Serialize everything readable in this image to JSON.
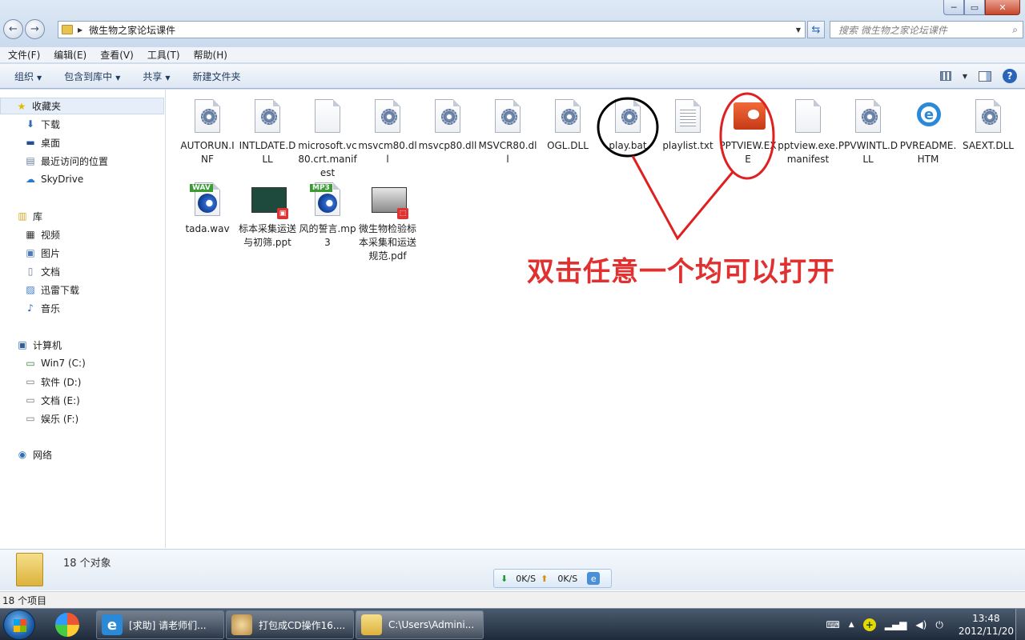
{
  "window": {
    "min_glyph": "─",
    "max_glyph": "▭",
    "close_glyph": "✕"
  },
  "address": {
    "path": "微生物之家论坛课件",
    "search_placeholder": "搜索 微生物之家论坛课件"
  },
  "menu": [
    "文件(F)",
    "编辑(E)",
    "查看(V)",
    "工具(T)",
    "帮助(H)"
  ],
  "commands": {
    "organize": "组织",
    "include_in_library": "包含到库中",
    "share": "共享",
    "new_folder": "新建文件夹"
  },
  "sidebar": {
    "favorites": {
      "label": "收藏夹",
      "items": [
        "下载",
        "桌面",
        "最近访问的位置",
        "SkyDrive"
      ]
    },
    "libraries": {
      "label": "库",
      "items": [
        "视频",
        "图片",
        "文档",
        "迅雷下载",
        "音乐"
      ]
    },
    "computer": {
      "label": "计算机",
      "items": [
        "Win7 (C:)",
        "软件 (D:)",
        "文档 (E:)",
        "娱乐 (F:)"
      ]
    },
    "network": {
      "label": "网络"
    }
  },
  "files": [
    {
      "name": "AUTORUN.INF",
      "icon": "config-gear-icon"
    },
    {
      "name": "INTLDATE.DLL",
      "icon": "config-gear-icon"
    },
    {
      "name": "microsoft.vc80.crt.manifest",
      "icon": "blank-file-icon"
    },
    {
      "name": "msvcm80.dll",
      "icon": "config-gear-icon"
    },
    {
      "name": "msvcp80.dll",
      "icon": "config-gear-icon"
    },
    {
      "name": "MSVCR80.dll",
      "icon": "config-gear-icon"
    },
    {
      "name": "OGL.DLL",
      "icon": "config-gear-icon"
    },
    {
      "name": "play.bat",
      "icon": "batch-gear-icon"
    },
    {
      "name": "playlist.txt",
      "icon": "text-file-icon"
    },
    {
      "name": "PPTVIEW.EXE",
      "icon": "powerpoint-viewer-icon"
    },
    {
      "name": "pptview.exe.manifest",
      "icon": "blank-file-icon"
    },
    {
      "name": "PPVWINTL.DLL",
      "icon": "config-gear-icon"
    },
    {
      "name": "PVREADME.HTM",
      "icon": "internet-explorer-icon"
    },
    {
      "name": "SAEXT.DLL",
      "icon": "config-gear-icon"
    },
    {
      "name": "tada.wav",
      "icon": "wav-media-icon",
      "tag": "WAV"
    },
    {
      "name": "标本采集运送与初筛.ppt",
      "icon": "ppt-thumbnail-icon"
    },
    {
      "name": "风的誓言.mp3",
      "icon": "mp3-media-icon",
      "tag": "MP3"
    },
    {
      "name": "微生物检验标本采集和运送规范.pdf",
      "icon": "pdf-thumbnail-icon"
    }
  ],
  "annotation": {
    "text": "双击任意一个均可以打开",
    "color": "#e03030"
  },
  "details": {
    "object_count": "18 个对象"
  },
  "speed": {
    "down": "0K/S",
    "up": "0K/S"
  },
  "status": {
    "item_count": "18 个项目"
  },
  "taskbar": {
    "buttons": [
      {
        "label": "[求助] 请老师们..."
      },
      {
        "label": "打包成CD操作16...."
      },
      {
        "label": "C:\\Users\\Admini..."
      }
    ],
    "clock_time": "13:48",
    "clock_date": "2012/11/20"
  }
}
